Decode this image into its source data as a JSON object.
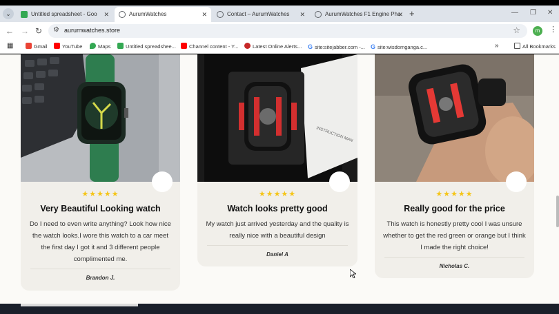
{
  "browser": {
    "tabs": [
      {
        "title": "Untitled spreadsheet - Google",
        "icon": "sheets-icon",
        "color": "#34a853",
        "active": false
      },
      {
        "title": "AurumWatches",
        "icon": "globe-icon",
        "color": "#5f6368",
        "active": true
      },
      {
        "title": "Contact – AurumWatches",
        "icon": "globe-icon",
        "color": "#5f6368",
        "active": false
      },
      {
        "title": "AurumWatches F1 Engine Pha",
        "icon": "globe-icon",
        "color": "#5f6368",
        "active": false
      }
    ],
    "url": "aurumwatches.store",
    "profile_initial": "m",
    "bookmarks": [
      {
        "label": "Gmail",
        "icon": "gmail-icon",
        "color": "#ea4335"
      },
      {
        "label": "YouTube",
        "icon": "youtube-icon",
        "color": "#ff0000"
      },
      {
        "label": "Maps",
        "icon": "maps-icon",
        "color": "#34a853"
      },
      {
        "label": "Untitled spreadshee...",
        "icon": "sheets-icon",
        "color": "#34a853"
      },
      {
        "label": "Channel content - Y...",
        "icon": "youtube-icon",
        "color": "#ff0000"
      },
      {
        "label": "Latest Online Alerts...",
        "icon": "alert-icon",
        "color": "#c62828"
      },
      {
        "label": "site:sitejabber.com -...",
        "icon": "google-icon",
        "color": "#4285f4"
      },
      {
        "label": "site:wisdomganga.c...",
        "icon": "google-icon",
        "color": "#4285f4"
      }
    ],
    "all_bookmarks": "All Bookmarks"
  },
  "reviews": [
    {
      "stars": "★★★★★",
      "title": "Very Beautiful Looking watch",
      "text": "Do I need to even write anything? Look how nice the watch looks.I wore this watch to a car meet the first day I got it and 3 different people complimented me.",
      "author": "Brandon J.",
      "rating": 5
    },
    {
      "stars": "★★★★★",
      "title": "Watch looks pretty good",
      "text": "My watch just arrived yesterday and the quality is really nice with a beautiful design",
      "author": "Daniel A",
      "rating": 5
    },
    {
      "stars": "★★★★★",
      "title": "Really good for the price",
      "text": "This watch is honestly pretty cool I was unsure whether to get the red green or orange but I think I made the right choice!",
      "author": "Nicholas C.",
      "rating": 5
    }
  ],
  "photo_text": {
    "instruction_card": "INSTRUCTION MAN"
  },
  "colors": {
    "star": "#f5c518",
    "card_bg": "#f1efea",
    "page_bg": "#fbfaf7",
    "accent_green": "#2e7d4f",
    "accent_red": "#d32f2f"
  }
}
